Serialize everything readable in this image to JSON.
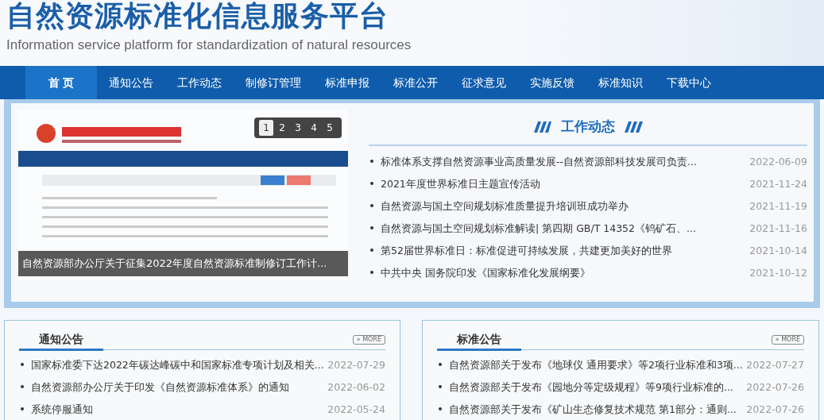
{
  "header": {
    "title": "自然资源标准化信息服务平台",
    "subtitle": "Information service platform for standardization of natural resources"
  },
  "nav": [
    {
      "label": "首 页",
      "selected": true
    },
    {
      "label": "通知公告",
      "selected": false
    },
    {
      "label": "工作动态",
      "selected": false
    },
    {
      "label": "制修订管理",
      "selected": false
    },
    {
      "label": "标准申报",
      "selected": false
    },
    {
      "label": "标准公开",
      "selected": false
    },
    {
      "label": "征求意见",
      "selected": false
    },
    {
      "label": "实施反馈",
      "selected": false
    },
    {
      "label": "标准知识",
      "selected": false
    },
    {
      "label": "下载中心",
      "selected": false
    }
  ],
  "carousel": {
    "caption": "自然资源部办公厅关于征集2022年度自然资源标准制修订工作计...",
    "pages": [
      {
        "label": "1",
        "selected": true
      },
      {
        "label": "2",
        "selected": false
      },
      {
        "label": "3",
        "selected": false
      },
      {
        "label": "4",
        "selected": false
      },
      {
        "label": "5",
        "selected": false
      }
    ]
  },
  "work_news": {
    "title": "工作动态",
    "items": [
      {
        "title": "标准体系支撑自然资源事业高质量发展--自然资源部科技发展司负责...",
        "date": "2022-06-09"
      },
      {
        "title": "2021年度世界标准日主题宣传活动",
        "date": "2021-11-24"
      },
      {
        "title": "自然资源与国土空间规划标准质量提升培训班成功举办",
        "date": "2021-11-19"
      },
      {
        "title": "自然资源与国土空间规划标准解读| 第四期 GB/T 14352《钨矿石、...",
        "date": "2021-11-16"
      },
      {
        "title": "第52届世界标准日：标准促进可持续发展，共建更加美好的世界",
        "date": "2021-10-14"
      },
      {
        "title": "中共中央 国务院印发《国家标准化发展纲要》",
        "date": "2021-10-12"
      }
    ]
  },
  "panels": [
    {
      "title": "通知公告",
      "more": "» MORE",
      "items": [
        {
          "title": "国家标准委下达2022年碳达峰碳中和国家标准专项计划及相关...",
          "date": "2022-07-29"
        },
        {
          "title": "自然资源部办公厅关于印发《自然资源标准体系》的通知",
          "date": "2022-06-02"
        },
        {
          "title": "系统停服通知",
          "date": "2022-05-24"
        }
      ]
    },
    {
      "title": "标准公告",
      "more": "» MORE",
      "items": [
        {
          "title": "自然资源部关于发布《地球仪 通用要求》等2项行业标准和3项...",
          "date": "2022-07-27"
        },
        {
          "title": "自然资源部关于发布《园地分等定级规程》等9项行业标准的...",
          "date": "2022-07-26"
        },
        {
          "title": "自然资源部关于发布《矿山生态修复技术规范 第1部分：通则...",
          "date": "2022-07-26"
        }
      ]
    }
  ]
}
